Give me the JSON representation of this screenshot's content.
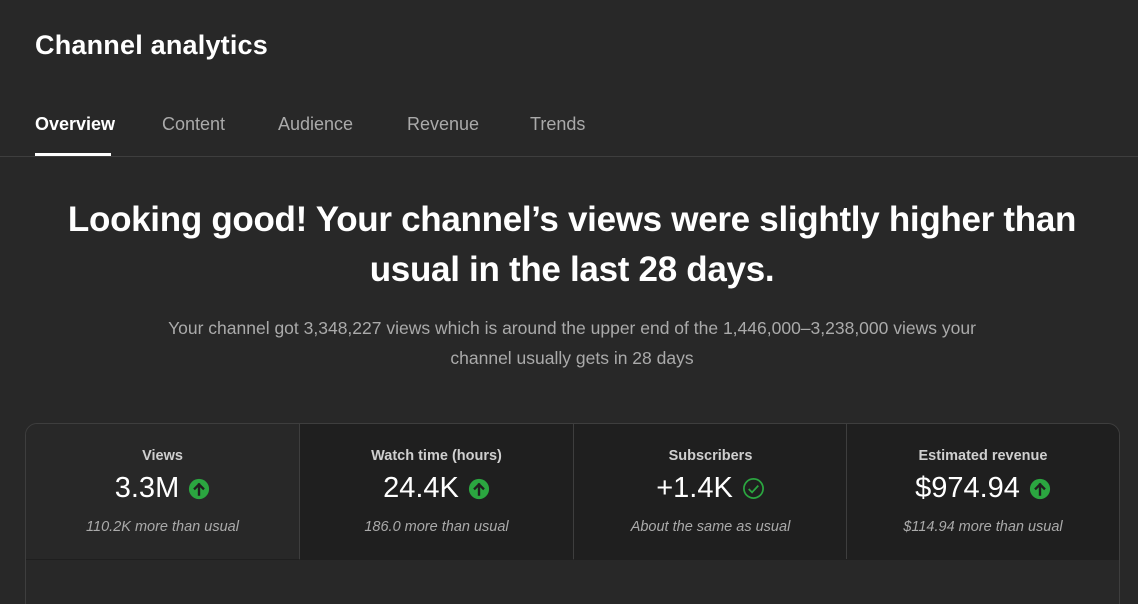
{
  "header": {
    "title": "Channel analytics"
  },
  "tabs": [
    {
      "label": "Overview",
      "active": true
    },
    {
      "label": "Content",
      "active": false
    },
    {
      "label": "Audience",
      "active": false
    },
    {
      "label": "Revenue",
      "active": false
    },
    {
      "label": "Trends",
      "active": false
    }
  ],
  "summary": {
    "headline_line1": "Looking good! Your channel’s views were slightly higher than",
    "headline_line2": "usual in the last 28 days.",
    "detail_line1": "Your channel got 3,348,227 views which is around the upper end of the 1,446,000–3,238,000 views your",
    "detail_line2": "channel usually gets in 28 days"
  },
  "metrics": [
    {
      "label": "Views",
      "value": "3.3M",
      "trend_icon": "arrow-up-circle-icon",
      "note": "110.2K more than usual",
      "selected": true
    },
    {
      "label": "Watch time (hours)",
      "value": "24.4K",
      "trend_icon": "arrow-up-circle-icon",
      "note": "186.0 more than usual",
      "selected": false
    },
    {
      "label": "Subscribers",
      "value": "+1.4K",
      "trend_icon": "check-circle-icon",
      "note": "About the same as usual",
      "selected": false
    },
    {
      "label": "Estimated revenue",
      "value": "$974.94",
      "trend_icon": "arrow-up-circle-icon",
      "note": "$114.94 more than usual",
      "selected": false
    }
  ],
  "colors": {
    "background": "#282828",
    "card_background": "#1f1f1f",
    "trend_up": "#2ba640",
    "muted_text": "#aaaaaa"
  }
}
